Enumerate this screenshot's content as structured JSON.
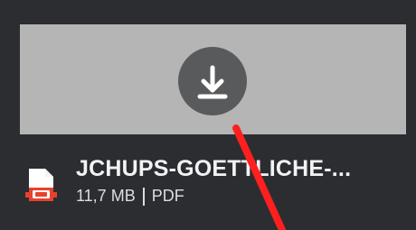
{
  "attachment": {
    "file_name": "JCHUPS-GOETTLICHE-...",
    "file_size": "11,7 MB",
    "file_type": "PDF",
    "icon": "pdf-file-icon",
    "action_icon": "download-icon"
  },
  "colors": {
    "background": "#2b2d31",
    "preview": "#b5b5b5",
    "button": "#595a5c",
    "annotation": "#ff1f1f",
    "file_icon_accent": "#e8412c"
  }
}
